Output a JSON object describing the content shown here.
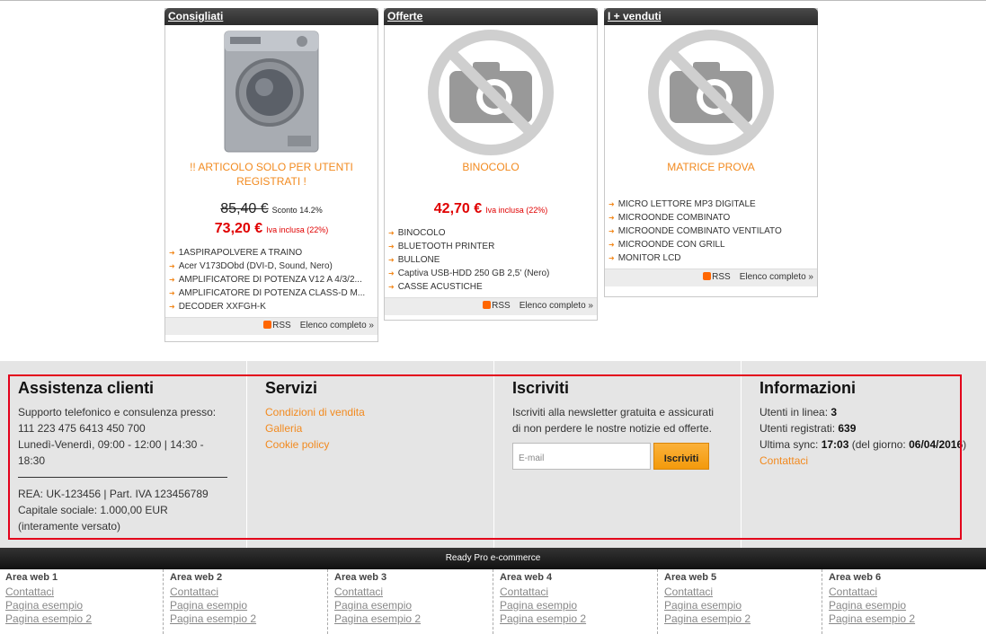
{
  "boxes": [
    {
      "title": "Consigliati",
      "product": "!! ARTICOLO SOLO PER UTENTI REGISTRATI !",
      "old_price": "85,40 €",
      "discount": "Sconto 14.2%",
      "price": "73,20 €",
      "vat": "Iva inclusa (22%)",
      "items": [
        "1ASPIRAPOLVERE A TRAINO",
        "Acer V173DObd (DVI-D, Sound, Nero)",
        "AMPLIFICATORE DI POTENZA V12 A 4/3/2...",
        "AMPLIFICATORE DI POTENZA CLASS-D M...",
        "DECODER XXFGH-K"
      ],
      "rss": "RSS",
      "all": "Elenco completo »"
    },
    {
      "title": "Offerte",
      "product": "BINOCOLO",
      "price": "42,70 €",
      "vat": "Iva inclusa (22%)",
      "items": [
        "BINOCOLO",
        "BLUETOOTH PRINTER",
        "BULLONE",
        "Captiva USB-HDD 250 GB 2,5' (Nero)",
        "CASSE ACUSTICHE"
      ],
      "rss": "RSS",
      "all": "Elenco completo »"
    },
    {
      "title": "I + venduti",
      "product": "MATRICE PROVA",
      "items": [
        "MICRO LETTORE MP3 DIGITALE",
        "MICROONDE COMBINATO",
        "MICROONDE COMBINATO VENTILATO",
        "MICROONDE CON GRILL",
        "MONITOR LCD"
      ],
      "rss": "RSS",
      "all": "Elenco completo »"
    }
  ],
  "assist": {
    "title": "Assistenza clienti",
    "l1": "Supporto telefonico e consulenza presso:",
    "l2": "111 223 475 6413 450 700",
    "l3": "Lunedì-Venerdì, 09:00 - 12:00 | 14:30 - 18:30",
    "l4": "REA: UK-123456 | Part. IVA 123456789",
    "l5": "Capitale sociale: 1.000,00 EUR (interamente versato)"
  },
  "services": {
    "title": "Servizi",
    "links": [
      "Condizioni di vendita",
      "Galleria",
      "Cookie policy"
    ]
  },
  "newsletter": {
    "title": "Iscriviti",
    "text": "Iscriviti alla newsletter gratuita e assicurati di non perdere le nostre notizie ed offerte.",
    "placeholder": "E-mail",
    "button": "Iscriviti"
  },
  "info": {
    "title": "Informazioni",
    "online_label": "Utenti in linea: ",
    "online": "3",
    "reg_label": "Utenti registrati: ",
    "reg": "639",
    "sync_label": "Ultima sync: ",
    "sync_time": "17:03",
    "sync_mid": " (del giorno: ",
    "sync_date": "06/04/2016",
    "sync_end": ")",
    "contact": "Contattaci"
  },
  "bar": "Ready Pro e-commerce",
  "areas": [
    {
      "title": "Area web 1",
      "links": [
        "Contattaci",
        "Pagina esempio",
        "Pagina esempio 2"
      ]
    },
    {
      "title": "Area web 2",
      "links": [
        "Contattaci",
        "Pagina esempio",
        "Pagina esempio 2"
      ]
    },
    {
      "title": "Area web 3",
      "links": [
        "Contattaci",
        "Pagina esempio",
        "Pagina esempio 2"
      ]
    },
    {
      "title": "Area web 4",
      "links": [
        "Contattaci",
        "Pagina esempio",
        "Pagina esempio 2"
      ]
    },
    {
      "title": "Area web 5",
      "links": [
        "Contattaci",
        "Pagina esempio",
        "Pagina esempio 2"
      ]
    },
    {
      "title": "Area web 6",
      "links": [
        "Contattaci",
        "Pagina esempio",
        "Pagina esempio 2"
      ]
    }
  ]
}
